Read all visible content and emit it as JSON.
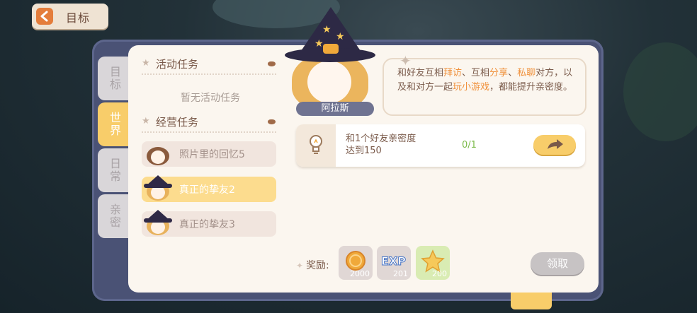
{
  "back_button": {
    "label": "目标"
  },
  "side_tabs": [
    {
      "label": "目标",
      "active": false
    },
    {
      "label": "世界",
      "active": true
    },
    {
      "label": "日常",
      "active": false
    },
    {
      "label": "亲密",
      "active": false
    }
  ],
  "task_list": {
    "activity_section": {
      "title": "活动任务",
      "empty_text": "暂无活动任务"
    },
    "business_section": {
      "title": "经营任务"
    },
    "tasks": [
      {
        "label": "照片里的回忆5",
        "active": false
      },
      {
        "label": "真正的挚友2",
        "active": true
      },
      {
        "label": "真正的挚友3",
        "active": false
      }
    ]
  },
  "npc": {
    "name": "阿拉斯"
  },
  "bubble": {
    "t1": "和好友互相",
    "h1": "拜访",
    "t2": "、互相",
    "h2": "分享",
    "t3": "、",
    "h3": "私聊",
    "t4": "对方，以及和对方一起",
    "h4": "玩小游戏",
    "t5": "，都能提升亲密度。"
  },
  "task_card": {
    "line1": "和1个好友亲密度",
    "line2": "达到150",
    "progress": "0/1",
    "icon": "lightbulb-icon"
  },
  "rewards": {
    "label": "奖励:",
    "items": [
      {
        "icon": "coin-icon",
        "amount": "2000"
      },
      {
        "icon": "exp-icon",
        "text": "EXP",
        "amount": "201"
      },
      {
        "icon": "star-icon",
        "amount": "200"
      }
    ]
  },
  "claim_button": {
    "label": "领取"
  },
  "colors": {
    "accent": "#f8cd6a",
    "frame": "#4a5275",
    "panel": "#fbf6ef",
    "highlight": "#f0903a",
    "progress": "#7cba4a"
  }
}
